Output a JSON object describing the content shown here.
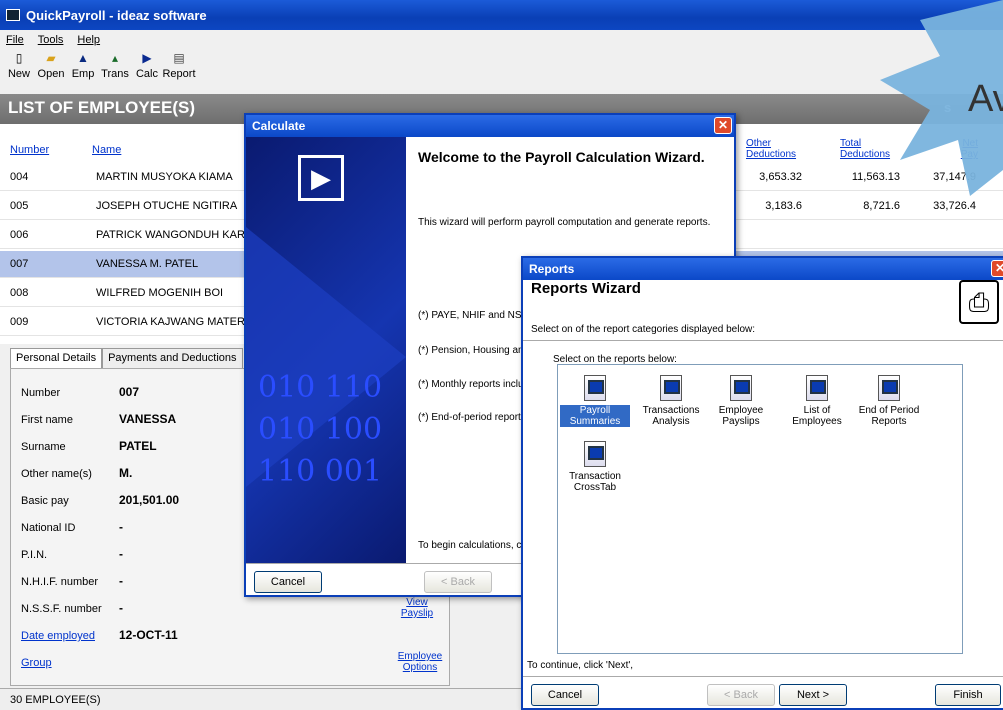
{
  "app": {
    "title": "QuickPayroll - ideaz software"
  },
  "menu": [
    "File",
    "Tools",
    "Help"
  ],
  "toolbar": [
    "New",
    "Open",
    "Emp",
    "Trans",
    "Calc",
    "Report"
  ],
  "header": {
    "title": "LIST OF EMPLOYEE(S)",
    "right_char": "s"
  },
  "columns": {
    "number": "Number",
    "name": "Name",
    "other_ded": "Other Deductions",
    "total_ded": "Total Deductions",
    "net_pay": "Net Pay"
  },
  "employees": [
    {
      "number": "004",
      "name": "MARTIN MUSYOKA KIAMA",
      "other": "3,653.32",
      "total": "11,563.13",
      "net": "37,147.9"
    },
    {
      "number": "005",
      "name": "JOSEPH OTUCHE NGITIRA",
      "other": "3,183.6",
      "total": "8,721.6",
      "net": "33,726.4"
    },
    {
      "number": "006",
      "name": "PATRICK WANGONDUH KARA",
      "other": "",
      "total": "",
      "net": ""
    },
    {
      "number": "007",
      "name": "VANESSA M. PATEL",
      "other": "",
      "total": "",
      "net": ""
    },
    {
      "number": "008",
      "name": "WILFRED MOGENIH BOI",
      "other": "",
      "total": "",
      "net": ""
    },
    {
      "number": "009",
      "name": "VICTORIA KAJWANG MATERE",
      "other": "",
      "total": "",
      "net": ""
    }
  ],
  "tabs": [
    "Personal Details",
    "Payments and Deductions"
  ],
  "details": [
    {
      "label": "Number",
      "value": "007",
      "link": false
    },
    {
      "label": "First name",
      "value": "VANESSA",
      "link": false
    },
    {
      "label": "Surname",
      "value": "PATEL",
      "link": false
    },
    {
      "label": "Other name(s)",
      "value": "M.",
      "link": false
    },
    {
      "label": "Basic pay",
      "value": "201,501.00",
      "link": false
    },
    {
      "label": "National ID",
      "value": "-",
      "link": false
    },
    {
      "label": "P.I.N.",
      "value": "-",
      "link": false
    },
    {
      "label": "N.H.I.F. number",
      "value": "-",
      "link": false
    },
    {
      "label": "N.S.S.F. number",
      "value": "-",
      "link": false
    },
    {
      "label": "Date employed",
      "value": "12-OCT-11",
      "link": true
    },
    {
      "label": "Group",
      "value": "",
      "link": true
    }
  ],
  "side_links": {
    "view_payslip": "View Payslip",
    "employee_options": "Employee Options"
  },
  "status": "30 EMPLOYEE(S)",
  "calc": {
    "title": "Calculate",
    "heading": "Welcome to the Payroll Calculation Wizard.",
    "intro": "This wizard will perform payroll computation and generate reports.",
    "bullets": [
      "(*) PAYE, NHIF and NSS",
      "(*) Pension, Housing and",
      "(*) Monthly reports includ",
      "(*) End-of-period reports c"
    ],
    "footer": "To begin calculations, c",
    "binary": [
      "010 110",
      "010 100",
      "110 001"
    ],
    "cancel": "Cancel",
    "back": "< Back"
  },
  "reports": {
    "title": "Reports",
    "heading": "Reports Wizard",
    "subtitle": "Select on of the report categories displayed below:",
    "group": "Select on the reports below:",
    "items": [
      "Payroll Summaries",
      "Transactions Analysis",
      "Employee Payslips",
      "List of Employees",
      "End of Period Reports",
      "Transaction CrossTab"
    ],
    "continue": "To continue, click 'Next',",
    "cancel": "Cancel",
    "back": "< Back",
    "next": "Next >",
    "finish": "Finish"
  },
  "corner_text": "Av"
}
